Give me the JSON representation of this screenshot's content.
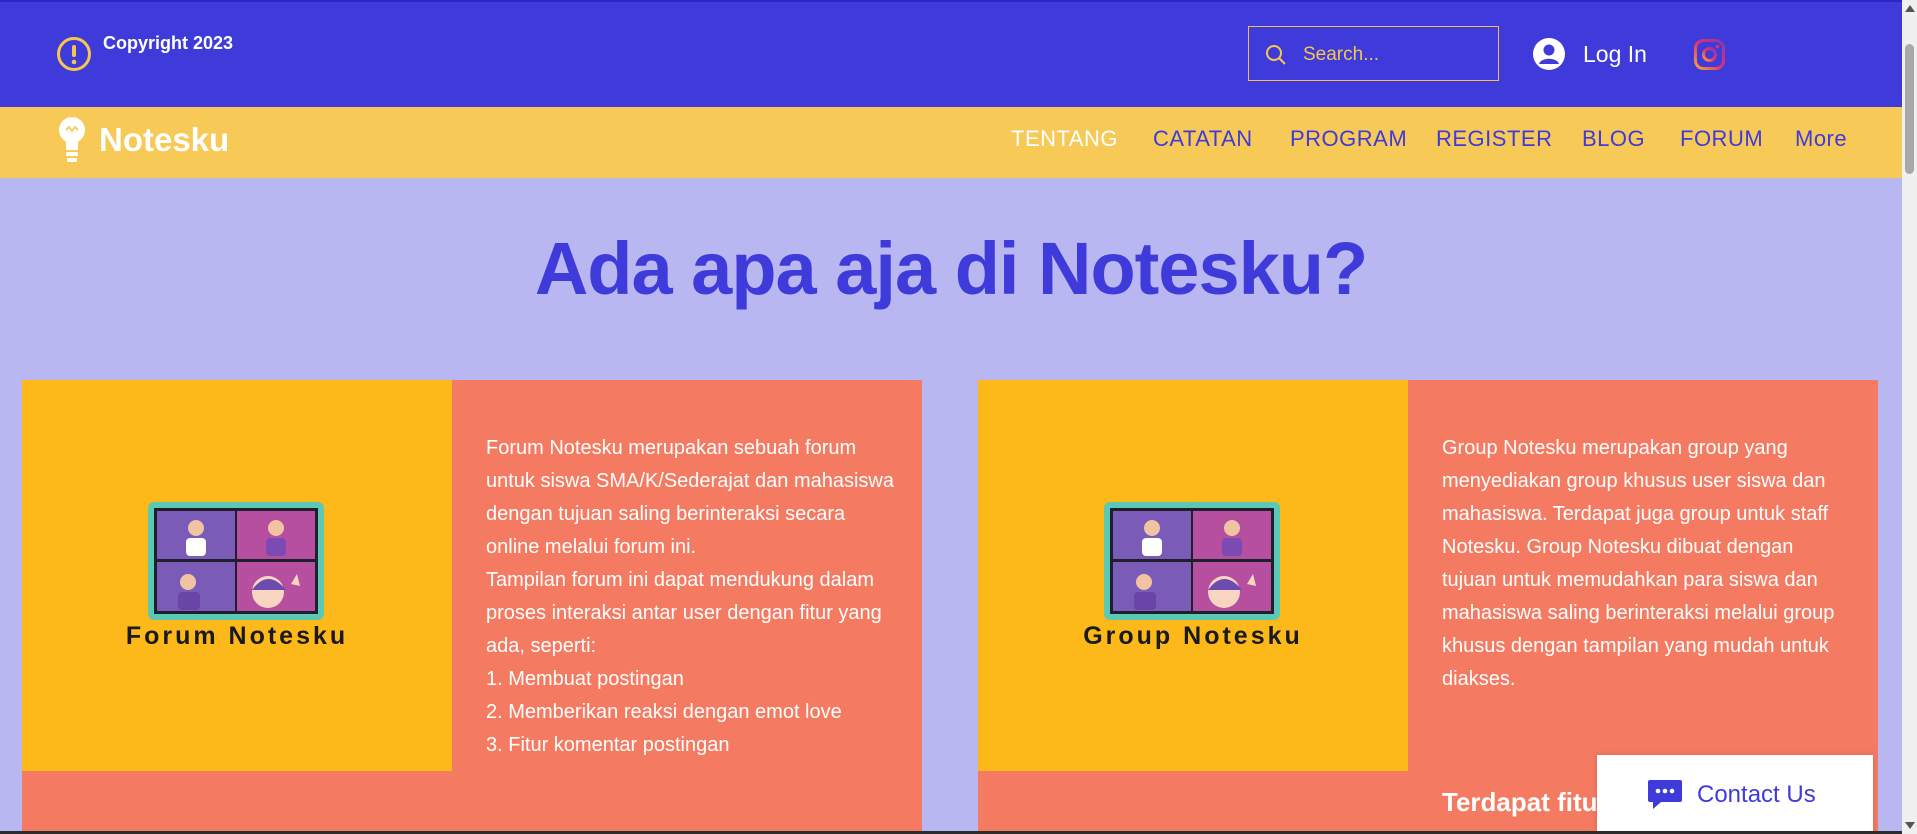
{
  "header": {
    "copyright": "Copyright 2023",
    "search_placeholder": "Search...",
    "login_label": "Log In",
    "icons": {
      "warning": "exclamation-circle-icon",
      "search": "search-icon",
      "avatar": "user-avatar-icon",
      "social": "instagram-icon"
    }
  },
  "nav": {
    "logo_text": "Notesku",
    "items": [
      {
        "label": "TENTANG",
        "active": true
      },
      {
        "label": "CATATAN",
        "active": false
      },
      {
        "label": "PROGRAM",
        "active": false
      },
      {
        "label": "REGISTER",
        "active": false
      },
      {
        "label": "BLOG",
        "active": false
      },
      {
        "label": "FORUM",
        "active": false
      },
      {
        "label": "More",
        "active": false
      }
    ]
  },
  "main": {
    "headline": "Ada apa aja di Notesku?",
    "cards": [
      {
        "image_title": "Forum Notesku",
        "lines": [
          "Forum Notesku merupakan sebuah forum untuk siswa SMA/K/Sederajat dan mahasiswa dengan tujuan saling berinteraksi secara online melalui forum ini.",
          "Tampilan forum ini dapat mendukung dalam proses interaksi antar user dengan fitur yang ada, seperti:",
          "1. Membuat postingan",
          "2. Memberikan reaksi dengan emot love",
          "3. Fitur komentar postingan"
        ]
      },
      {
        "image_title": "Group Notesku",
        "lines": [
          "Group Notesku merupakan group yang menyediakan group khusus user siswa dan mahasiswa. Terdapat juga group untuk staff Notesku. Group Notesku dibuat dengan tujuan untuk memudahkan para siswa dan mahasiswa saling berinteraksi melalui group khusus dengan tampilan yang mudah untuk diakses."
        ],
        "subheading": "Terdapat fitur"
      }
    ]
  },
  "contact": {
    "label": "Contact Us",
    "icon": "chat-bubble-icon"
  },
  "colors": {
    "primary": "#3f3bdb",
    "nav_bg": "#f7c956",
    "page_bg": "#b9b7f2",
    "card_image_bg": "#fdb91a",
    "card_bg": "#f47b62"
  }
}
